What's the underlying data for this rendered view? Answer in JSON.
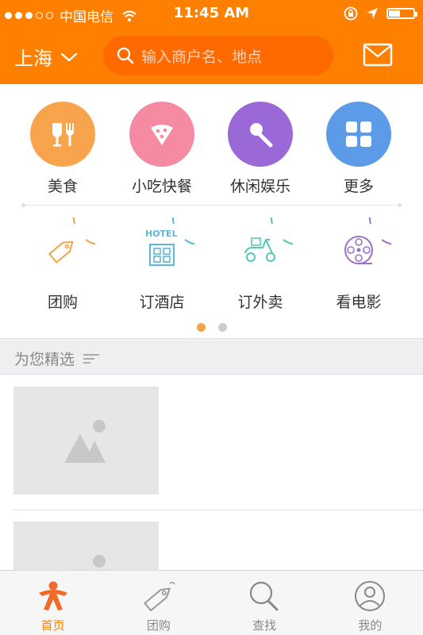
{
  "status_bar": {
    "signal_dots_filled": 3,
    "signal_dots_total": 5,
    "carrier": "中国电信",
    "time": "11:45 AM",
    "battery_level": 0.45
  },
  "nav": {
    "city": "上海",
    "search_placeholder": "输入商户名、地点",
    "mail_icon": "mail-icon"
  },
  "categories": [
    {
      "label": "美食",
      "icon": "food-icon",
      "color": "#F8A44C"
    },
    {
      "label": "小吃快餐",
      "icon": "pizza-slice-icon",
      "color": "#F58BA2"
    },
    {
      "label": "休闲娱乐",
      "icon": "microphone-icon",
      "color": "#9B68D8"
    },
    {
      "label": "更多",
      "icon": "grid-icon",
      "color": "#5B9BE8"
    },
    {
      "label": "团购",
      "icon": "tag-icon",
      "color": "#F0A54A"
    },
    {
      "label": "订酒店",
      "icon": "hotel-icon",
      "color": "#5BB8D8",
      "badge": "HOTEL"
    },
    {
      "label": "订外卖",
      "icon": "scooter-icon",
      "color": "#54C7B2"
    },
    {
      "label": "看电影",
      "icon": "film-reel-icon",
      "color": "#9A72C9"
    }
  ],
  "pager": {
    "pages": 2,
    "current": 1
  },
  "section": {
    "title": "为您精选"
  },
  "tabs": [
    {
      "label": "首页",
      "icon": "home-person-icon",
      "active": true
    },
    {
      "label": "团购",
      "icon": "tag-icon",
      "active": false
    },
    {
      "label": "查找",
      "icon": "search-icon",
      "active": false
    },
    {
      "label": "我的",
      "icon": "user-icon",
      "active": false
    }
  ],
  "colors": {
    "brand": "#FF7F00",
    "brand_dark": "#FF6A00",
    "tab_active": "#FF7F00"
  }
}
